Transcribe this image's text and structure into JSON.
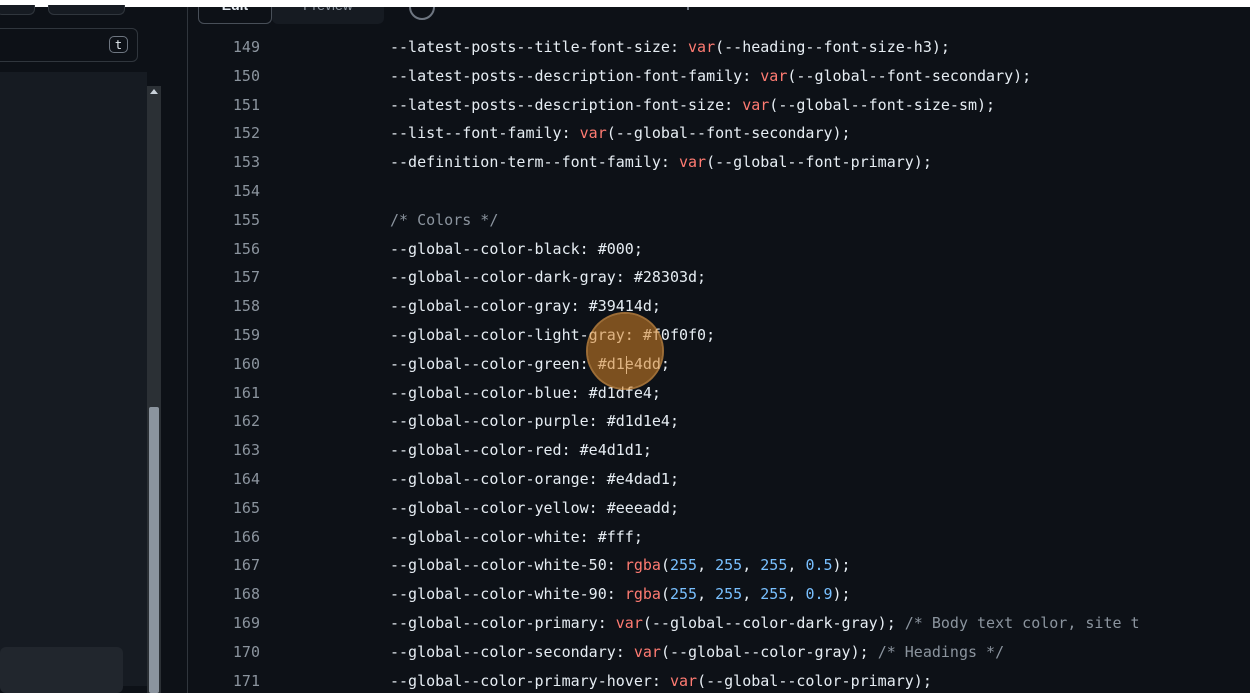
{
  "sidebar": {
    "filter_shortcut_key": "t"
  },
  "editor": {
    "tabs": [
      {
        "label": "Edit"
      },
      {
        "label": "Preview"
      }
    ],
    "lines": [
      {
        "number": "149",
        "text": "--latest-posts--title-font-size: var(--heading--font-size-h3);"
      },
      {
        "number": "150",
        "text": "--latest-posts--description-font-family: var(--global--font-secondary);"
      },
      {
        "number": "151",
        "text": "--latest-posts--description-font-size: var(--global--font-size-sm);"
      },
      {
        "number": "152",
        "text": "--list--font-family: var(--global--font-secondary);"
      },
      {
        "number": "153",
        "text": "--definition-term--font-family: var(--global--font-primary);"
      },
      {
        "number": "154",
        "text": ""
      },
      {
        "number": "155",
        "text": "/* Colors */"
      },
      {
        "number": "156",
        "text": "--global--color-black: #000;"
      },
      {
        "number": "157",
        "text": "--global--color-dark-gray: #28303d;"
      },
      {
        "number": "158",
        "text": "--global--color-gray: #39414d;"
      },
      {
        "number": "159",
        "text": "--global--color-light-gray: #f0f0f0;"
      },
      {
        "number": "160",
        "text": "--global--color-green: #d1e4dd;"
      },
      {
        "number": "161",
        "text": "--global--color-blue: #d1dfe4;"
      },
      {
        "number": "162",
        "text": "--global--color-purple: #d1d1e4;"
      },
      {
        "number": "163",
        "text": "--global--color-red: #e4d1d1;"
      },
      {
        "number": "164",
        "text": "--global--color-orange: #e4dad1;"
      },
      {
        "number": "165",
        "text": "--global--color-yellow: #eeeadd;"
      },
      {
        "number": "166",
        "text": "--global--color-white: #fff;"
      },
      {
        "number": "167",
        "text": "--global--color-white-50: rgba(255, 255, 255, 0.5);"
      },
      {
        "number": "168",
        "text": "--global--color-white-90: rgba(255, 255, 255, 0.9);"
      },
      {
        "number": "169",
        "text": "--global--color-primary: var(--global--color-dark-gray); /* Body text color, site t"
      },
      {
        "number": "170",
        "text": "--global--color-secondary: var(--global--color-gray); /* Headings */"
      },
      {
        "number": "171",
        "text": "--global--color-primary-hover: var(--global--color-primary);"
      }
    ]
  },
  "colors": {
    "background": "#0d1117",
    "text": "#e6edf3",
    "line_number": "#8b949e",
    "keyword": "#ff7b72",
    "number": "#79c0ff",
    "comment": "#8b949e",
    "click_indicator": "#d98526"
  }
}
